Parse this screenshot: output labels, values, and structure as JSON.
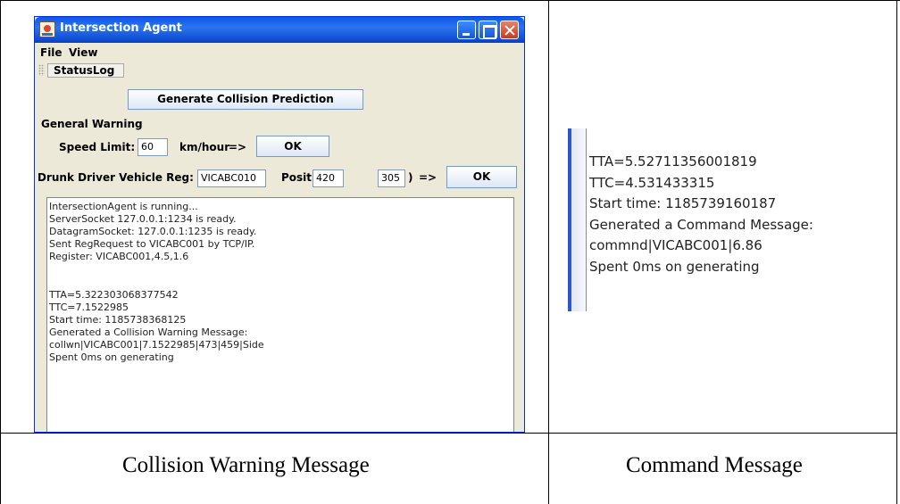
{
  "window": {
    "title": "Intersection Agent",
    "menus": [
      "File",
      "View"
    ],
    "toolbar_tab": "StatusLog"
  },
  "controls": {
    "generate_button": "Generate Collision Prediction",
    "general_warning_label": "General Warning",
    "speed_limit_label": "Speed Limit:",
    "speed_limit_value": "60",
    "speed_unit": "km/hour",
    "arrow": "=>",
    "ok_label": "OK",
    "drunk_driver_label": "Drunk Driver Vehicle Reg:",
    "vehicle_reg_value": "VICABC010",
    "position_label": "Position:(",
    "position_x": "420",
    "position_y": "305",
    "position_close": ")"
  },
  "status_log": [
    "IntersectionAgent is running...",
    "ServerSocket 127.0.0.1:1234 is ready.",
    "DatagramSocket: 127.0.0.1:1235 is ready.",
    "Sent RegRequest to VICABC001 by TCP/IP.",
    "Register: VICABC001,4.5,1.6",
    "",
    "",
    "TTA=5.322303068377542",
    "TTC=7.1522985",
    "Start time: 1185738368125",
    "Generated a Collision Warning Message:",
    "collwn|VICABC001|7.1522985|473|459|Side",
    "Spent 0ms on generating"
  ],
  "command_log": [
    "TTA=5.52711356001819",
    "TTC=4.531433315",
    "Start time: 1185739160187",
    "Generated a Command Message:",
    "commnd|VICABC001|6.86",
    "Spent 0ms on generating"
  ],
  "captions": {
    "left": "Collision Warning Message",
    "right": "Command Message"
  }
}
